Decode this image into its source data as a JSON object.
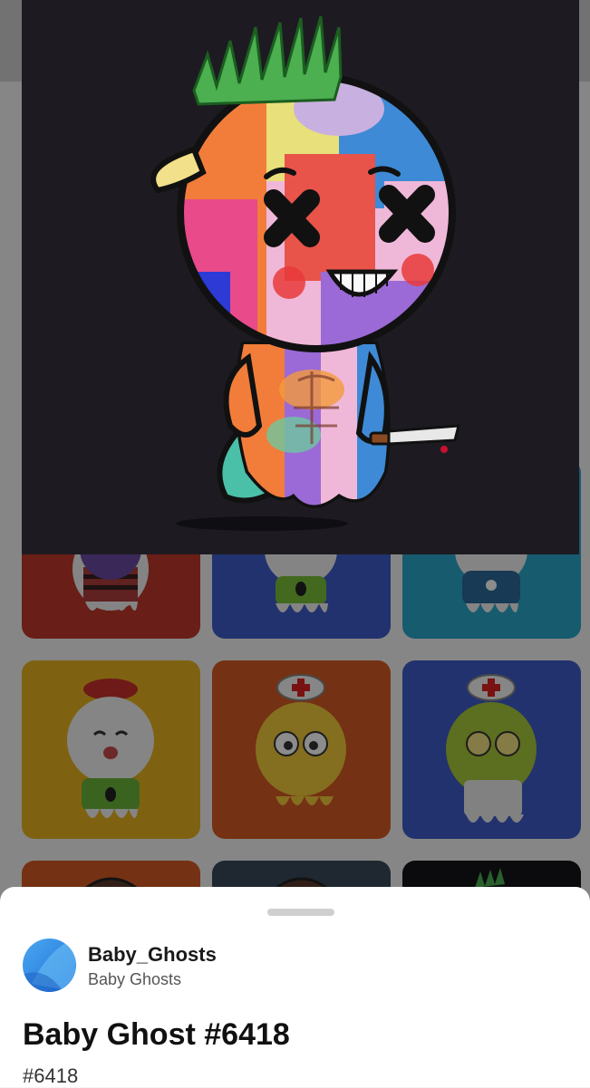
{
  "collection": {
    "handle": "Baby_Ghosts",
    "name": "Baby Ghosts"
  },
  "nft": {
    "title": "Baby Ghost #6418",
    "token_id": "#6418"
  },
  "colors": {
    "hero_bg": "#1d1b21",
    "sheet_bg": "#ffffff",
    "tile_red": "#c0392b",
    "tile_blue": "#3f5bc9",
    "tile_teal": "#2aa6c8",
    "tile_yellow": "#e7b31f",
    "tile_orange": "#d65a23"
  },
  "icons": {
    "avatar": "collection-avatar-icon"
  }
}
